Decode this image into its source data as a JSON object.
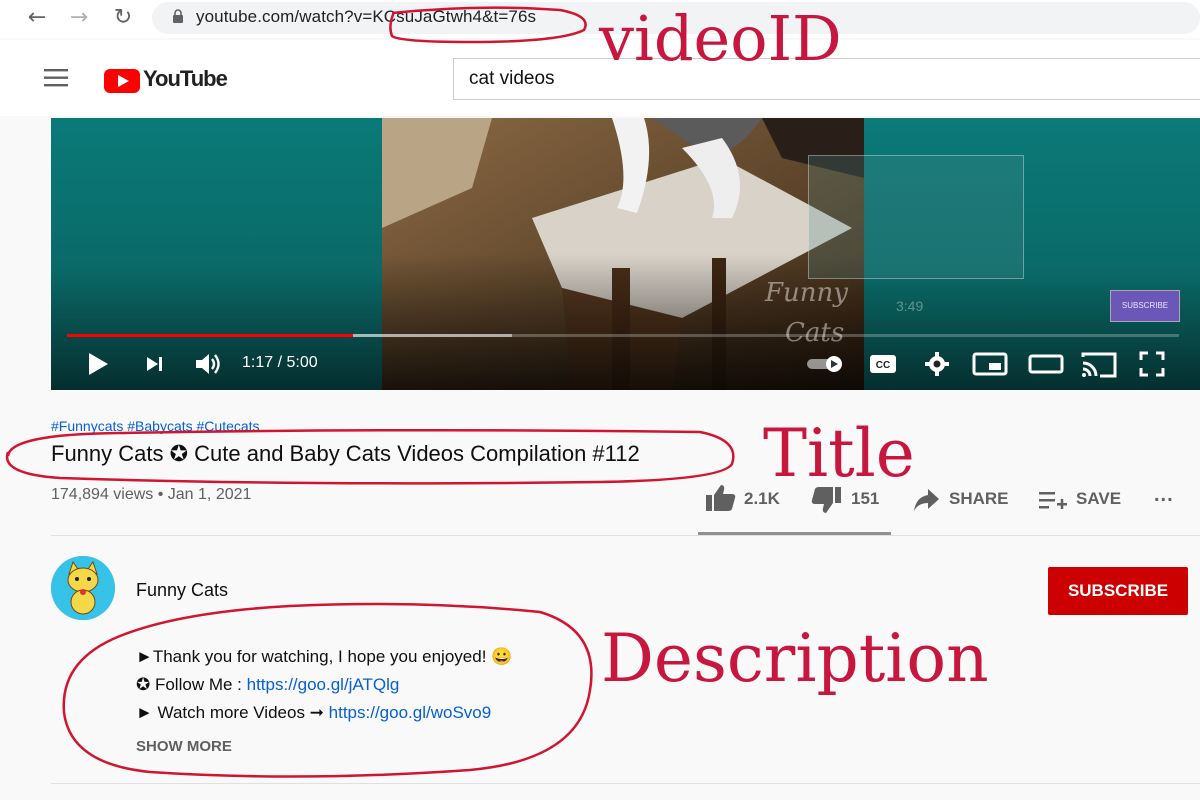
{
  "browser": {
    "url": "youtube.com/watch?v=KCsuJaGtwh4&t=76s"
  },
  "header": {
    "wordmark": "YouTube",
    "search_value": "cat videos"
  },
  "player": {
    "time": "1:17 / 5:00",
    "progress_played": 0.257,
    "progress_buffered": 0.4,
    "overlay_time": "3:49",
    "overlay_subscribe": "SUBSCRIBE",
    "watermark_line1": "Funny",
    "watermark_line2": "Cats"
  },
  "video": {
    "hashtags": "#Funnycats #Babycats #Cutecats",
    "title": "Funny Cats ✪ Cute and Baby Cats Videos Compilation #112",
    "views_date": "174,894 views • Jan 1, 2021",
    "likes": "2.1K",
    "dislikes": "151",
    "share_label": "SHARE",
    "save_label": "SAVE",
    "more_label": "..."
  },
  "channel": {
    "name": "Funny Cats",
    "subscribe_label": "SUBSCRIBE"
  },
  "description": {
    "line1": "►Thank you for watching, I hope you enjoyed! 😀",
    "line2_prefix": "✪ Follow Me : ",
    "line2_link": "https://goo.gl/jATQlg",
    "line3_prefix": "► Watch more Videos ➞ ",
    "line3_link": "https://goo.gl/woSvo9",
    "show_more": "SHOW MORE"
  },
  "annotations": {
    "video_id": "videoID",
    "title": "Title",
    "description": "Description",
    "color": "#c8173f"
  }
}
